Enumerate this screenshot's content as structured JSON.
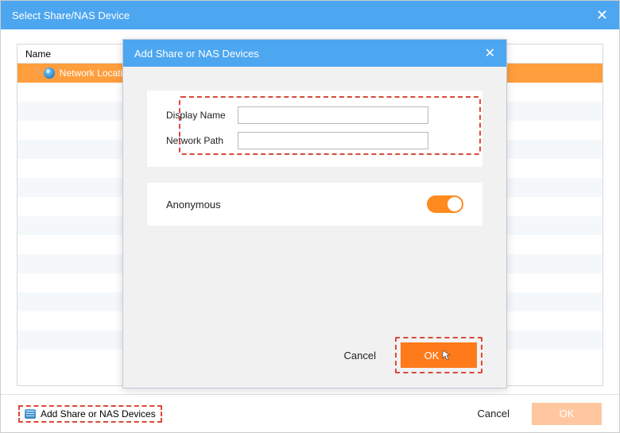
{
  "mainWindow": {
    "title": "Select Share/NAS Device",
    "table": {
      "column": "Name",
      "selectedItem": "Network Locations"
    },
    "footer": {
      "addButton": "Add Share or NAS Devices",
      "cancel": "Cancel",
      "ok": "OK"
    }
  },
  "modal": {
    "title": "Add Share or NAS Devices",
    "fields": {
      "displayName": {
        "label": "Display Name",
        "value": ""
      },
      "networkPath": {
        "label": "Network Path",
        "value": ""
      }
    },
    "anonymous": {
      "label": "Anonymous",
      "enabled": true
    },
    "buttons": {
      "cancel": "Cancel",
      "ok": "OK"
    }
  }
}
